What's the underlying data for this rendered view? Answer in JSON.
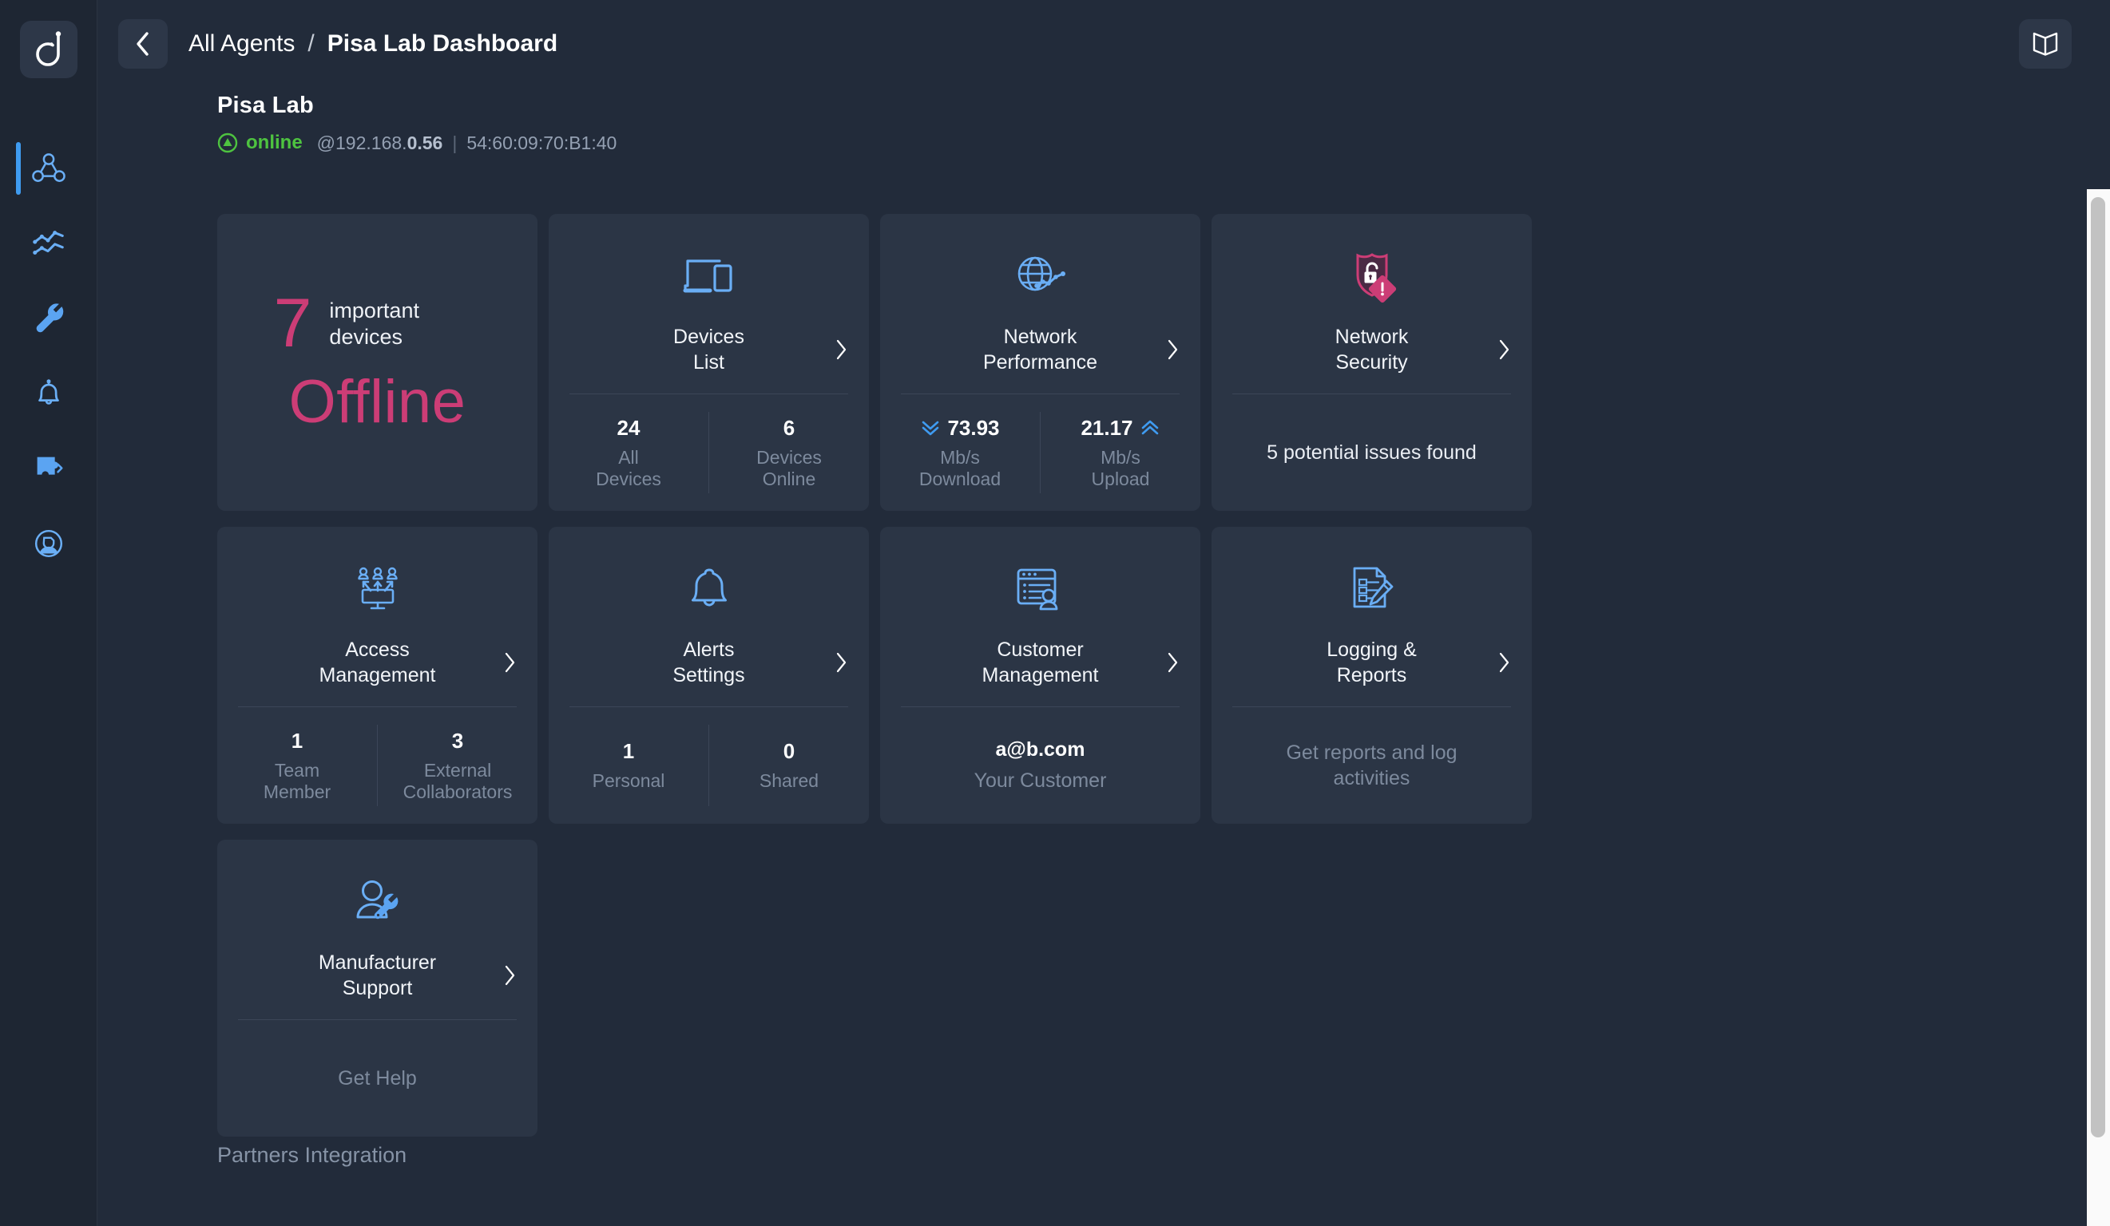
{
  "colors": {
    "bg": "#222b3a",
    "rail_bg": "#1e2633",
    "card_bg": "#2b3545",
    "accent_blue": "#6aaef5",
    "active_blue": "#3f9bf0",
    "accent_pink": "#cc3d76",
    "status_green": "#4ec340",
    "text_primary": "#ffffff",
    "text_muted": "#7d8a9d"
  },
  "rail": {
    "logo": "dootrix-logo-icon",
    "items": [
      {
        "icon": "network-topology-icon",
        "name": "agents",
        "active": true
      },
      {
        "icon": "analytics-chart-icon",
        "name": "analytics",
        "active": false
      },
      {
        "icon": "wrench-icon",
        "name": "tools",
        "active": false
      },
      {
        "icon": "bell-icon",
        "name": "alerts",
        "active": false
      },
      {
        "icon": "puzzle-plugin-icon",
        "name": "integrations",
        "active": false
      },
      {
        "icon": "user-circle-icon",
        "name": "account",
        "active": false
      }
    ]
  },
  "topbar": {
    "back_icon": "chevron-left-icon",
    "breadcrumb_root": "All Agents",
    "breadcrumb_separator": "/",
    "breadcrumb_current": "Pisa Lab Dashboard",
    "book_icon": "open-book-icon"
  },
  "agent": {
    "name": "Pisa Lab",
    "status_icon": "status-online-icon",
    "status": "online",
    "ip_prefix": "@192.168.",
    "ip_suffix": "0.56",
    "separator": "|",
    "mac": "54:60:09:70:B1:40"
  },
  "cards": {
    "offline": {
      "name": "important-devices-offline",
      "count": "7",
      "subtitle": "important devices",
      "headline": "Offline"
    },
    "devices_list": {
      "icon": "devices-laptop-phone-icon",
      "title": "Devices List",
      "title_line1": "Devices",
      "title_line2": "List",
      "chevron": "chevron-right-icon",
      "stats": [
        {
          "value": "24",
          "label_line1": "All",
          "label_line2": "Devices"
        },
        {
          "value": "6",
          "label_line1": "Devices",
          "label_line2": "Online"
        }
      ]
    },
    "network_performance": {
      "icon": "globe-chart-icon",
      "title": "Network Performance",
      "title_line1": "Network",
      "title_line2": "Performance",
      "chevron": "chevron-right-icon",
      "stats": [
        {
          "icon": "double-chevron-down-icon",
          "value": "73.93",
          "label_line1": "Mb/s",
          "label_line2": "Download"
        },
        {
          "icon": "double-chevron-up-icon",
          "value": "21.17",
          "label_line1": "Mb/s",
          "label_line2": "Upload"
        }
      ]
    },
    "network_security": {
      "icon": "shield-unlock-warning-icon",
      "title": "Network Security",
      "title_line1": "Network",
      "title_line2": "Security",
      "chevron": "chevron-right-icon",
      "note": "5 potential issues found"
    },
    "access_management": {
      "icon": "users-access-monitor-icon",
      "title": "Access Management",
      "title_line1": "Access",
      "title_line2": "Management",
      "chevron": "chevron-right-icon",
      "stats": [
        {
          "value": "1",
          "label_line1": "Team",
          "label_line2": "Member"
        },
        {
          "value": "3",
          "label_line1": "External",
          "label_line2": "Collaborators"
        }
      ]
    },
    "alerts_settings": {
      "icon": "bell-icon",
      "title": "Alerts Settings",
      "title_line1": "Alerts",
      "title_line2": "Settings",
      "chevron": "chevron-right-icon",
      "stats": [
        {
          "value": "1",
          "label_line1": "Personal",
          "label_line2": ""
        },
        {
          "value": "0",
          "label_line1": "Shared",
          "label_line2": ""
        }
      ]
    },
    "customer_management": {
      "icon": "browser-user-icon",
      "title": "Customer Management",
      "title_line1": "Customer",
      "title_line2": "Management",
      "chevron": "chevron-right-icon",
      "note_value": "a@b.com",
      "note_label": "Your Customer"
    },
    "logging_reports": {
      "icon": "document-pencil-icon",
      "title": "Logging & Reports",
      "title_line1": "Logging &",
      "title_line2": "Reports",
      "chevron": "chevron-right-icon",
      "note_line1": "Get reports and log",
      "note_line2": "activities"
    },
    "manufacturer_support": {
      "icon": "user-wrench-icon",
      "title": "Manufacturer Support",
      "title_line1": "Manufacturer",
      "title_line2": "Support",
      "chevron": "chevron-right-icon",
      "note": "Get Help"
    }
  },
  "footer": {
    "partners_heading": "Partners Integration"
  }
}
